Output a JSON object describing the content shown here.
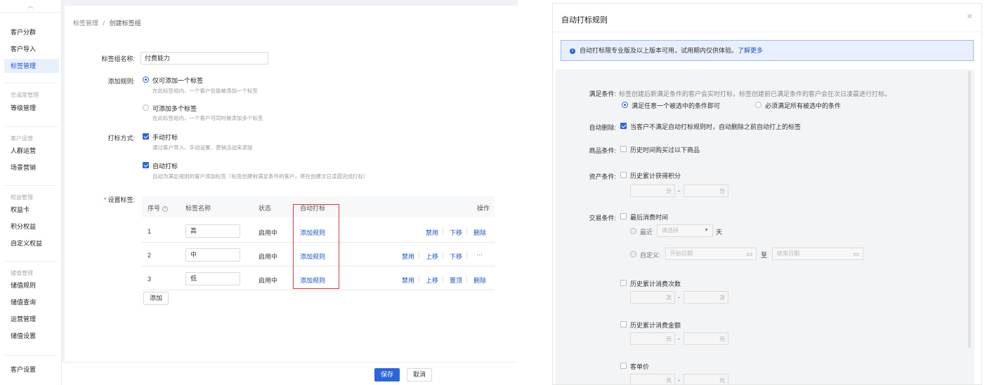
{
  "left": {
    "sidebar": {
      "collapse_icon": "chevron-up-icon",
      "items": [
        {
          "label": "客户分群"
        },
        {
          "label": "客户导入"
        },
        {
          "label": "标签管理",
          "active": true
        }
      ],
      "groups": [
        {
          "title": "忠诚度管理",
          "items": [
            {
              "label": "等级管理"
            }
          ]
        },
        {
          "title": "客户运营",
          "items": [
            {
              "label": "人群运营"
            },
            {
              "label": "场景营销"
            }
          ]
        },
        {
          "title": "权益管理",
          "items": [
            {
              "label": "权益卡"
            },
            {
              "label": "积分权益"
            },
            {
              "label": "自定义权益"
            }
          ]
        },
        {
          "title": "储值管理",
          "items": [
            {
              "label": "储值规则"
            },
            {
              "label": "储值查询"
            },
            {
              "label": "运营管理"
            },
            {
              "label": "储值设置"
            }
          ]
        }
      ],
      "bottom_item": "客户设置"
    },
    "breadcrumb": {
      "parent": "标签管理",
      "sep": "/",
      "current": "创建标签组"
    },
    "form": {
      "group_name_label": "标签组名称:",
      "group_name_value": "付费能力",
      "add_rule_label": "添加规则:",
      "add_rule_options": [
        {
          "title": "仅可添加一个标签",
          "desc": "在此标签组内，一个客户仅能被添加一个标签",
          "selected": true
        },
        {
          "title": "可添加多个标签",
          "desc": "在此标签组内，一个客户可同时被添加多个标签",
          "selected": false
        }
      ],
      "tag_method_label": "打标方式:",
      "tag_methods": [
        {
          "title": "手动打标",
          "desc": "通过客户导入、手动设置、营销活动来添加",
          "checked": true
        },
        {
          "title": "自动打标",
          "desc": "自动为满足规则的客户添加标签（标签创建前满足条件的客户，将在创建次日凌晨完成打标）",
          "checked": true
        }
      ],
      "tags_label": "设置标签:",
      "required_mark": "*"
    },
    "table": {
      "headers": {
        "index": "序号",
        "name": "标签名称",
        "status": "状态",
        "auto": "自动打标",
        "ops": "操作"
      },
      "rows": [
        {
          "index": "1",
          "name": "高",
          "status": "启用中",
          "auto": "添加规则",
          "ops": [
            "禁用",
            "下移",
            "删除"
          ]
        },
        {
          "index": "2",
          "name": "中",
          "status": "启用中",
          "auto": "添加规则",
          "ops": [
            "禁用",
            "上移",
            "下移",
            "···"
          ]
        },
        {
          "index": "3",
          "name": "低",
          "status": "启用中",
          "auto": "添加规则",
          "ops": [
            "禁用",
            "上移",
            "置顶",
            "删除"
          ]
        }
      ],
      "add_button": "添加",
      "highlight_color": "#e0353b"
    },
    "footer": {
      "save": "保存",
      "cancel": "取消"
    },
    "colors": {
      "accent": "#2a66d9"
    }
  },
  "right": {
    "title": "自动打标规则",
    "close_icon": "close-icon",
    "notice": {
      "text": "自动打标限专业版及以上版本可用，试用期内仅供体验。",
      "link": "了解更多",
      "icon": "info-icon"
    },
    "conditions": {
      "label": "满足条件:",
      "desc": "标签创建后新满足条件的客户会实时打标，标签创建前已满足条件的客户会在次日凌晨进行打标。",
      "options": [
        {
          "text": "满足任意一个被选中的条件即可",
          "selected": true
        },
        {
          "text": "必须满足所有被选中的条件",
          "selected": false
        }
      ]
    },
    "auto_delete": {
      "label": "自动删除:",
      "text": "当客户不满足自动打标规则时，自动删除之前自动打上的标签",
      "checked": true
    },
    "product": {
      "label": "商品条件:",
      "text": "历史时间购买过以下商品",
      "checked": false
    },
    "asset": {
      "label": "资产条件:",
      "text": "历史累计获得积分",
      "unit": "分",
      "dash": "-",
      "checked": false
    },
    "trade": {
      "label": "交易条件:",
      "last_time": {
        "text": "最后消费时间",
        "checked": false
      },
      "recent": {
        "text": "最近",
        "select_placeholder": "请选择",
        "unit": "天"
      },
      "custom": {
        "text": "自定义:",
        "start_placeholder": "开始日期",
        "to": "至",
        "end_placeholder": "结束日期"
      },
      "count": {
        "text": "历史累计消费次数",
        "unit": "次",
        "checked": false
      },
      "amount": {
        "text": "历史累计消费金额",
        "unit": "元",
        "checked": false
      },
      "avg": {
        "text": "客单价",
        "unit": "元",
        "checked": false
      }
    }
  }
}
